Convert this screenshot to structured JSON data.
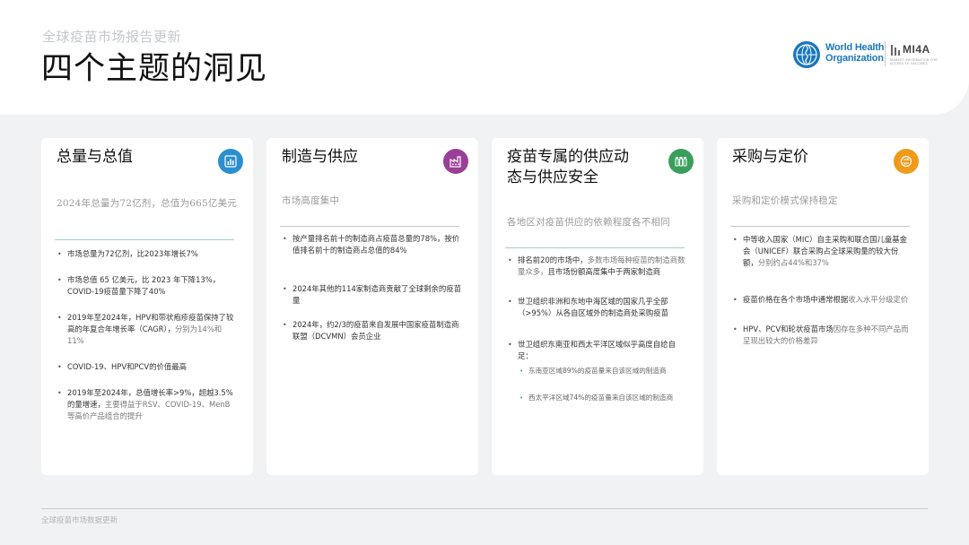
{
  "header": {
    "supertitle": "全球疫苗市场报告更新",
    "title": "四个主题的洞见",
    "who_logo": "World Health\nOrganization",
    "mipa_logo": "MI4A",
    "mipa_tagline": "MARKET INFORMATION FOR ACCESS TO VACCINES"
  },
  "colors": {
    "card1_icon": "#2a8fd1",
    "card2_icon": "#9a3e96",
    "card3_icon": "#3a9e5c",
    "card4_icon": "#ef9a1a",
    "teal_divider": "#9fd0cc",
    "gray_divider": "#c7c7c7"
  },
  "cards": [
    {
      "title": "总量与总值",
      "icon": "bar-chart-icon",
      "subtitle": "2024年总量为72亿剂，总值为665亿美元",
      "bullets": [
        {
          "text": "市场总量为72亿剂，比2023年增长7%"
        },
        {
          "text": "市场总值 65 亿美元，比 2023 年下降13%，COVID-19疫苗量下降了40%"
        },
        {
          "text": "2019年至2024年，HPV和带状疱疹疫苗保持了较高的年复合年增长率（CAGR），",
          "muted": "分别为14%和11%"
        },
        {
          "text": "COVID-19、HPV和PCV的价值最高"
        },
        {
          "text": "2019年至2024年，总值增长率>9%，超越3.5%的量增速，",
          "muted": "主要得益于RSV、COVID-19、MenB等高价产品组合的提升"
        }
      ]
    },
    {
      "title": "制造与供应",
      "icon": "factory-icon",
      "subtitle": "市场高度集中",
      "bullets": [
        {
          "text": "按产量排名前十的制造商占疫苗总量的78%，按价值排名前十的制造商占总值的84%"
        },
        {
          "text": "2024年其他的114家制造商贡献了全球剩余的疫苗量"
        },
        {
          "text": "2024年，约2/3的疫苗来自发展中国家疫苗制造商联盟（DCVMN）会员企业"
        }
      ]
    },
    {
      "title": "疫苗专属的供应动态与供应安全",
      "icon": "vaccine-vials-icon",
      "subtitle": "各地区对疫苗供应的依赖程度各不相同",
      "bullets": [
        {
          "text": "排名前20的市场中，",
          "muted": "多数市场每种疫苗的制造商数量众多，",
          "tail": "且市场份额高度集中于两家制造商"
        },
        {
          "text": "世卫组织非洲和东地中海区域的国家几乎全部（>95%）从各自区域外的制造商处采购疫苗"
        },
        {
          "text": "世卫组织东南亚和西太平洋区域似乎高度自给自足：",
          "sub": [
            "东南亚区域89%的疫苗量来自该区域的制造商",
            "西太平洋区域74%的疫苗量来自该区域的制造商"
          ]
        }
      ]
    },
    {
      "title": "采购与定价",
      "icon": "price-exchange-icon",
      "subtitle": "采购和定价模式保持稳定",
      "bullets": [
        {
          "text": "中等收入国家（MIC）自主采购和联合国儿童基金会（UNICEF）联合采购占全球采购量的较大份额，",
          "muted": "分别约占44%和37%"
        },
        {
          "text": "疫苗价格在各个市场中通常根据",
          "muted": "收入水平分级定价"
        },
        {
          "text": "HPV、PCV和轮状疫苗市场",
          "muted": "因存在多种不同产品而呈现出较大的价格差异"
        }
      ]
    }
  ],
  "footer": {
    "text": "全球疫苗市场数据更新"
  }
}
